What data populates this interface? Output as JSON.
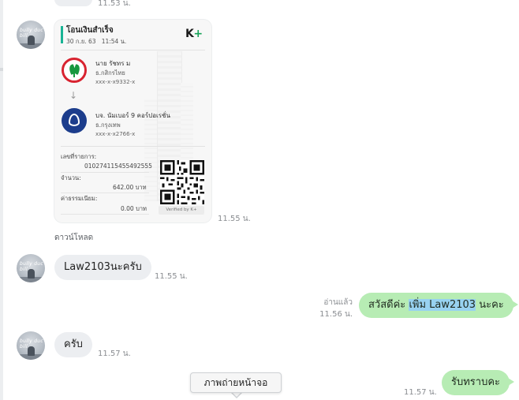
{
  "messages": {
    "top_time": "11.53 น.",
    "receipt": {
      "title": "โอนเงินสำเร็จ",
      "date": "30 ก.ย. 63",
      "time": "11:54 น.",
      "brand": "K",
      "brand_plus": "+",
      "sender_name": "นาย รัชทร ม",
      "sender_bank": "ธ.กสิกรไทย",
      "sender_account": "xxx-x-x9332-x",
      "receiver_name": "บจ. นัมเบอร์ 9 คอร์ปอเรชั่น",
      "receiver_bank": "ธ.กรุงเทพ",
      "receiver_account": "xxx-x-x2766-x",
      "ref_label": "เลขที่รายการ:",
      "ref_value": "010274115455492555",
      "amount_label": "จำนวน:",
      "amount_value": "642.00 บาท",
      "fee_label": "ค่าธรรมเนียม:",
      "fee_value": "0.00 บาท",
      "verified": "Verified by K+",
      "sent_time": "11.55 น."
    },
    "download_label": "ดาวน์โหลด",
    "in_1": {
      "text": "Law2103นะครับ",
      "time": "11.55 น."
    },
    "out_1": {
      "read": "อ่านแล้ว",
      "time": "11.56 น.",
      "text_pre": "สวัสดีค่ะ ",
      "text_highlight": "เพิ่ม Law2103",
      "text_post": " นะคะ"
    },
    "in_2": {
      "text": "ครับ",
      "time": "11.57 น."
    },
    "out_2": {
      "text": "รับทราบคะ",
      "time": "11.57 น."
    }
  },
  "avatar_caption": "bully  duc  bill",
  "screenshot_tooltip": "ภาพถ่ายหน้าจอ",
  "colors": {
    "incoming_bubble": "#eceef1",
    "outgoing_bubble": "#b7ecb4",
    "highlight": "#98d2f0",
    "kbank_red": "#d82330",
    "kbank_green": "#17983f",
    "bbl_blue": "#1c3d8c"
  }
}
